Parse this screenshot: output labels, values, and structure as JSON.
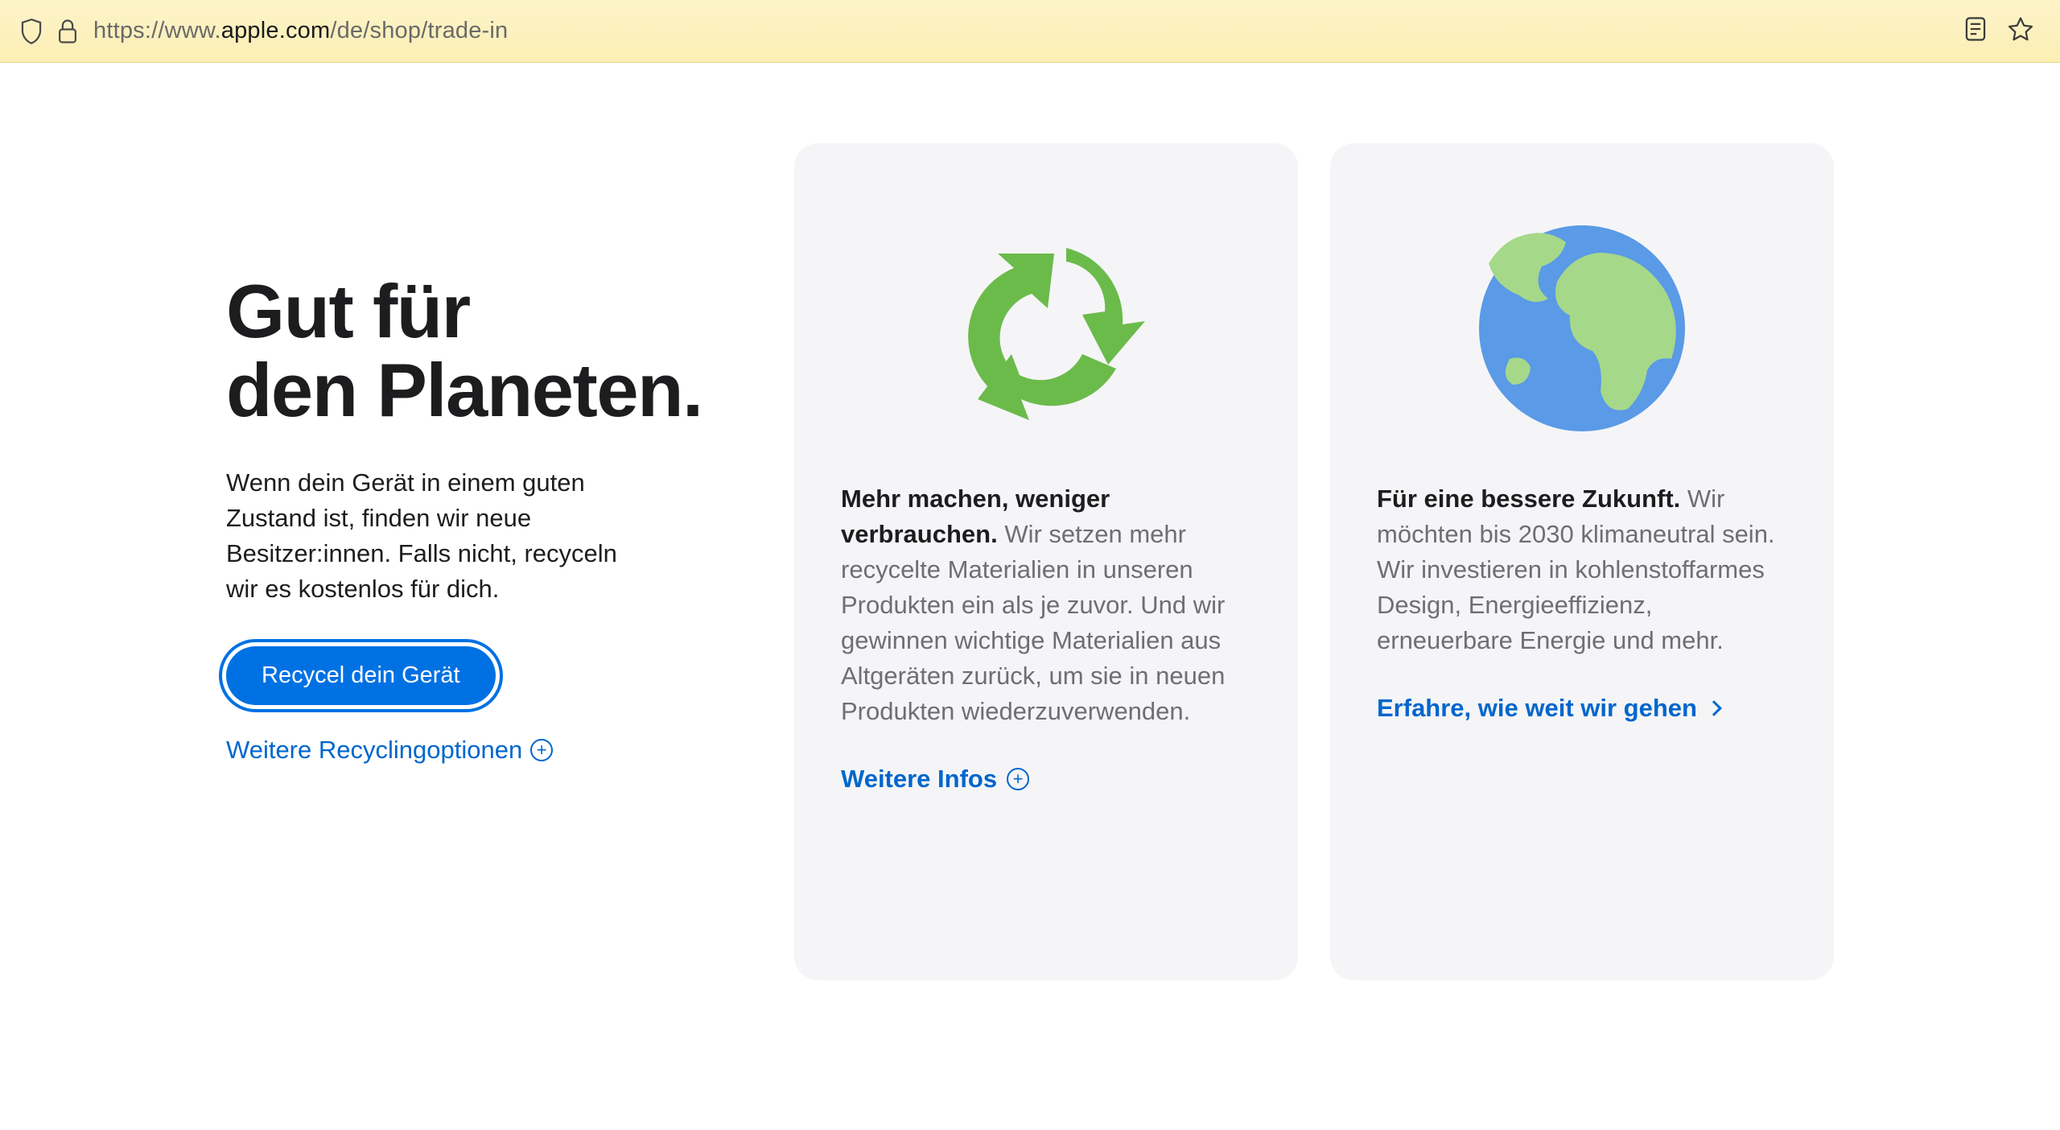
{
  "browser": {
    "url_prefix": "https://www.",
    "url_domain": "apple.com",
    "url_path": "/de/shop/trade-in"
  },
  "hero": {
    "title_line1": "Gut für",
    "title_line2": "den Planeten.",
    "description": "Wenn dein Gerät in einem guten Zustand ist, finden wir neue Besitzer:innen. Falls nicht, recyceln wir es kostenlos für dich.",
    "cta_label": "Recycel dein Gerät",
    "more_label": "Weitere Recyclingoptionen"
  },
  "cards": [
    {
      "lead": "Mehr machen, weniger verbrauchen.",
      "body": " Wir setzen mehr recycelte Materialien in unseren Produkten ein als je zuvor. Und wir gewinnen wichtige Materialien aus Altgeräten zurück, um sie in neuen Produkten wiederzuverwenden.",
      "link": "Weitere Infos"
    },
    {
      "lead": "Für eine bessere Zukunft.",
      "body": " Wir möchten bis 2030 klimaneutral sein. Wir investieren in kohlenstoffarmes Design, Energieeffizienz, erneuerbare Energie und mehr.",
      "link": "Erfahre, wie weit wir gehen"
    }
  ],
  "colors": {
    "accent": "#0071e3",
    "link": "#0066cc",
    "card_bg": "#f5f5f7",
    "recycle_green": "#68bถ43"
  }
}
